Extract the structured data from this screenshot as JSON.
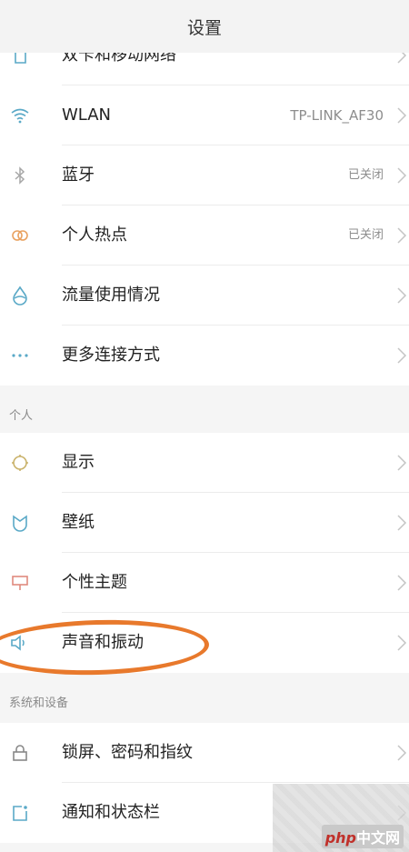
{
  "header": {
    "title": "设置"
  },
  "network": {
    "items": [
      {
        "label": "双卡和移动网络",
        "value": "",
        "icon": "sim-card-icon"
      },
      {
        "label": "WLAN",
        "value": "TP-LINK_AF30",
        "icon": "wifi-icon"
      },
      {
        "label": "蓝牙",
        "value": "已关闭",
        "icon": "bluetooth-icon"
      },
      {
        "label": "个人热点",
        "value": "已关闭",
        "icon": "hotspot-icon"
      },
      {
        "label": "流量使用情况",
        "value": "",
        "icon": "data-drop-icon"
      },
      {
        "label": "更多连接方式",
        "value": "",
        "icon": "more-dots-icon"
      }
    ]
  },
  "personal": {
    "header": "个人",
    "items": [
      {
        "label": "显示",
        "icon": "brightness-icon"
      },
      {
        "label": "壁纸",
        "icon": "wallpaper-icon"
      },
      {
        "label": "个性主题",
        "icon": "theme-brush-icon"
      },
      {
        "label": "声音和振动",
        "icon": "speaker-icon"
      }
    ]
  },
  "system": {
    "header": "系统和设备",
    "items": [
      {
        "label": "锁屏、密码和指纹",
        "icon": "lock-icon"
      },
      {
        "label": "通知和状态栏",
        "icon": "notification-icon"
      }
    ]
  },
  "watermark": {
    "php": "php",
    "text": "中文网"
  },
  "colors": {
    "accent": "#5aa9c7",
    "highlight": "#e8792c"
  }
}
